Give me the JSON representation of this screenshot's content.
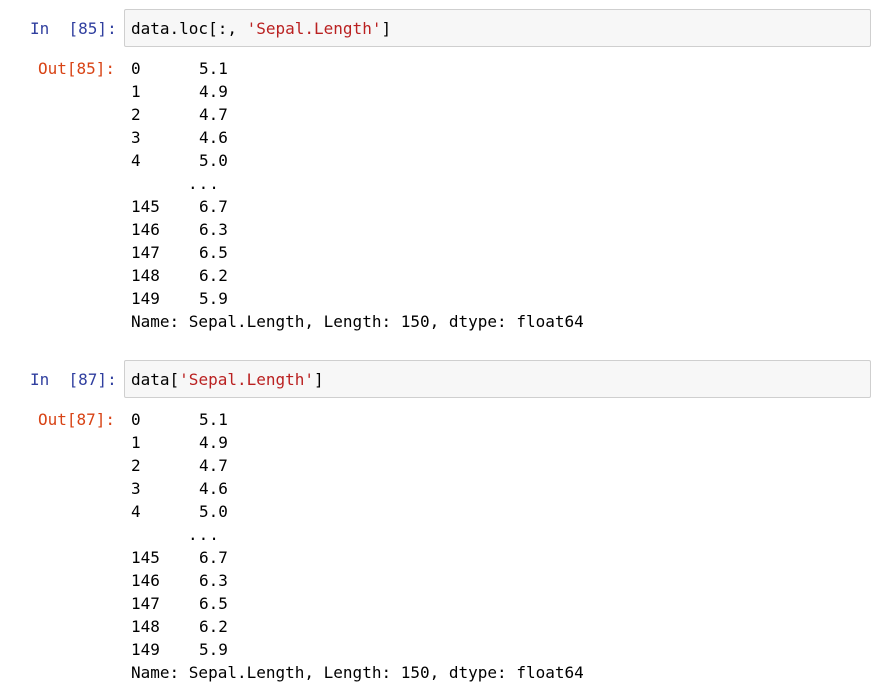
{
  "cells": [
    {
      "in_prompt": "In  [85]:",
      "code_prefix": "data.loc[:, ",
      "code_string": "'Sepal.Length'",
      "code_suffix": "]",
      "out_prompt": "Out[85]:",
      "head": [
        {
          "index": "0",
          "value": "5.1"
        },
        {
          "index": "1",
          "value": "4.9"
        },
        {
          "index": "2",
          "value": "4.7"
        },
        {
          "index": "3",
          "value": "4.6"
        },
        {
          "index": "4",
          "value": "5.0"
        }
      ],
      "ellipsis": "...",
      "tail": [
        {
          "index": "145",
          "value": "6.7"
        },
        {
          "index": "146",
          "value": "6.3"
        },
        {
          "index": "147",
          "value": "6.5"
        },
        {
          "index": "148",
          "value": "6.2"
        },
        {
          "index": "149",
          "value": "5.9"
        }
      ],
      "meta": "Name: Sepal.Length, Length: 150, dtype: float64"
    },
    {
      "in_prompt": "In  [87]:",
      "code_prefix": "data[",
      "code_string": "'Sepal.Length'",
      "code_suffix": "]",
      "out_prompt": "Out[87]:",
      "head": [
        {
          "index": "0",
          "value": "5.1"
        },
        {
          "index": "1",
          "value": "4.9"
        },
        {
          "index": "2",
          "value": "4.7"
        },
        {
          "index": "3",
          "value": "4.6"
        },
        {
          "index": "4",
          "value": "5.0"
        }
      ],
      "ellipsis": "...",
      "tail": [
        {
          "index": "145",
          "value": "6.7"
        },
        {
          "index": "146",
          "value": "6.3"
        },
        {
          "index": "147",
          "value": "6.5"
        },
        {
          "index": "148",
          "value": "6.2"
        },
        {
          "index": "149",
          "value": "5.9"
        }
      ],
      "meta": "Name: Sepal.Length, Length: 150, dtype: float64"
    }
  ]
}
